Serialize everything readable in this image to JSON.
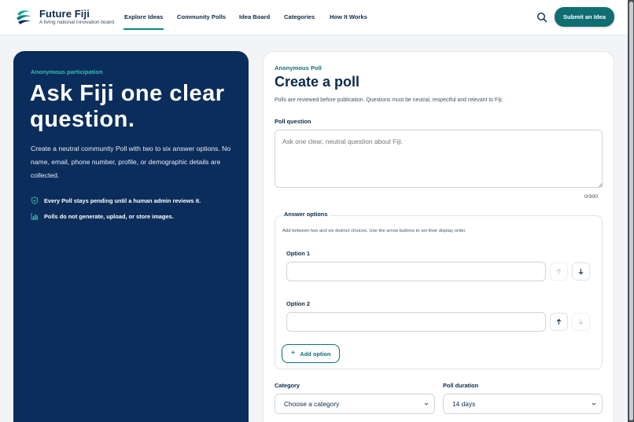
{
  "header": {
    "brand_title": "Future Fiji",
    "brand_subtitle": "A living national innovation board",
    "nav": [
      "Explore Ideas",
      "Community Polls",
      "Idea Board",
      "Categories",
      "How It Works"
    ],
    "active_nav": "Explore Ideas",
    "submit_label": "Submit an Idea"
  },
  "hero": {
    "kicker": "Anonymous participation",
    "title": "Ask Fiji one clear question.",
    "body": "Create a neutral community Poll with two to six answer options. No name, email, phone number, profile, or demographic details are collected.",
    "points": [
      {
        "icon": "shield-check-icon",
        "text": "Every Poll stays pending until a human admin reviews it."
      },
      {
        "icon": "bar-chart-icon",
        "text": "Polls do not generate, upload, or store images."
      }
    ]
  },
  "form": {
    "kicker": "Anonymous Poll",
    "title": "Create a poll",
    "description": "Polls are reviewed before publication. Questions must be neutral, respectful and relevant to Fiji.",
    "question_label": "Poll question",
    "question_placeholder": "Ask one clear, neutral question about Fiji.",
    "question_value": "",
    "char_count": "0/300",
    "options_legend": "Answer options",
    "options_help": "Add between two and six distinct choices. Use the arrow buttons to set their display order.",
    "options": [
      {
        "label": "Option 1",
        "value": "",
        "up_enabled": false,
        "down_enabled": true
      },
      {
        "label": "Option 2",
        "value": "",
        "up_enabled": true,
        "down_enabled": false
      }
    ],
    "add_option_label": "Add option",
    "category_label": "Category",
    "category_value": "Choose a category",
    "duration_label": "Poll duration",
    "duration_value": "14 days"
  },
  "colors": {
    "navy": "#0b2d5b",
    "teal": "#106e73",
    "accent_teal": "#35c0b3"
  }
}
